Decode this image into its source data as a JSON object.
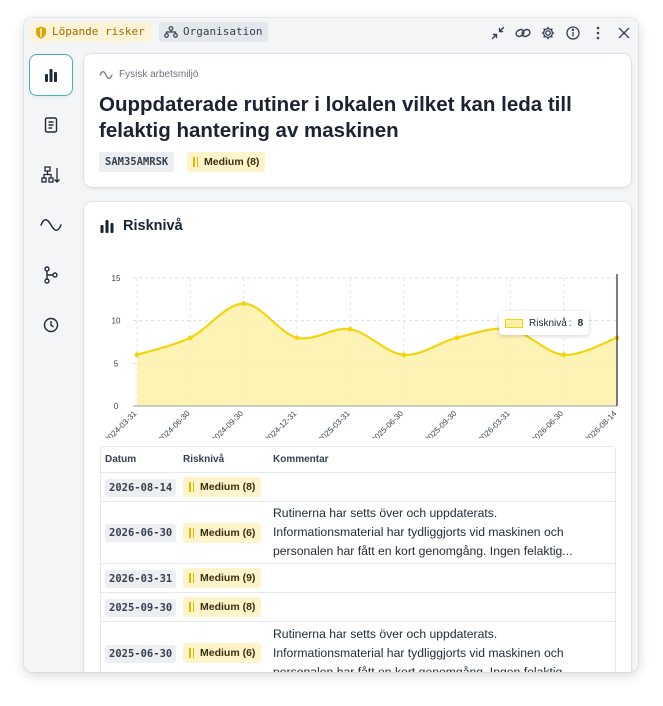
{
  "header": {
    "tag_risk": "Löpande risker",
    "tag_org": "Organisation"
  },
  "risk": {
    "category": "Fysisk arbetsmiljö",
    "title": "Ouppdaterade rutiner i lokalen vilket kan leda till felaktig hantering av maskinen",
    "code": "SAM35AMRSK",
    "level_label": "Medium (8)"
  },
  "section": {
    "title": "Risknivå"
  },
  "colors": {
    "accent": "#4ab3b7",
    "series_stroke": "#f2d410",
    "series_fill": "#fdf1a8",
    "badge_bg": "#fdf5c9",
    "cursor": "#1f2937"
  },
  "chart_data": {
    "type": "area",
    "x": [
      "2024-03-31",
      "2024-06-30",
      "2024-09-30",
      "2024-12-31",
      "2025-03-31",
      "2025-06-30",
      "2025-09-30",
      "2026-03-31",
      "2026-06-30",
      "2026-08-14"
    ],
    "series": [
      {
        "name": "Risknivå",
        "values": [
          6,
          8,
          12,
          8,
          9,
          6,
          8,
          9,
          6,
          8
        ]
      }
    ],
    "yticks": [
      "0",
      "5",
      "10",
      "15"
    ],
    "ylim": [
      0,
      15
    ],
    "grid": true,
    "tooltip": {
      "label": "Risknivå",
      "value": "8"
    }
  },
  "table": {
    "headers": [
      "Datum",
      "Risknivå",
      "Kommentar"
    ],
    "rows": [
      {
        "date": "2026-08-14",
        "level": "Medium (8)",
        "comment": ""
      },
      {
        "date": "2026-06-30",
        "level": "Medium (6)",
        "comment": "Rutinerna har setts över och uppdaterats. Informationsmaterial har tydliggjorts vid maskinen och personalen har fått en kort genomgång. Ingen felaktig..."
      },
      {
        "date": "2026-03-31",
        "level": "Medium (9)",
        "comment": ""
      },
      {
        "date": "2025-09-30",
        "level": "Medium (8)",
        "comment": ""
      },
      {
        "date": "2025-06-30",
        "level": "Medium (6)",
        "comment": "Rutinerna har setts över och uppdaterats. Informationsmaterial har tydliggjorts vid maskinen och personalen har fått en kort genomgång. Ingen felaktig"
      }
    ]
  }
}
